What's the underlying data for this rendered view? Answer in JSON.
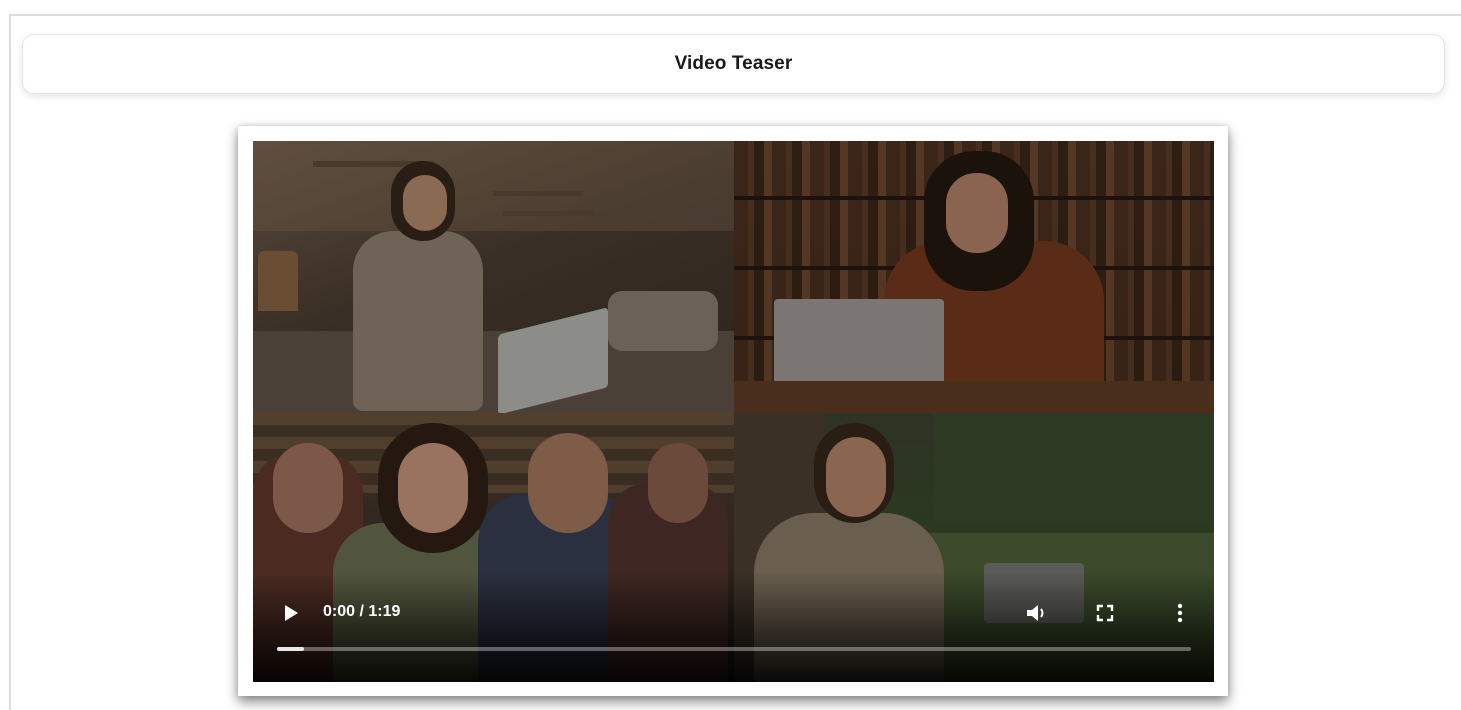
{
  "page": {
    "title": "Video Teaser"
  },
  "video_player": {
    "time_display": "0:00 / 1:19",
    "current_time": "0:00",
    "duration": "1:19",
    "buffered_fraction": 0.03,
    "is_playing": false,
    "icons": {
      "play": "play-icon",
      "volume": "volume-icon",
      "fullscreen": "fullscreen-icon",
      "more": "more-options-icon"
    }
  },
  "colors": {
    "page_background": "#ffffff",
    "title_text": "#1a1a1a",
    "player_background": "#000000",
    "controls_foreground": "#ffffff"
  }
}
